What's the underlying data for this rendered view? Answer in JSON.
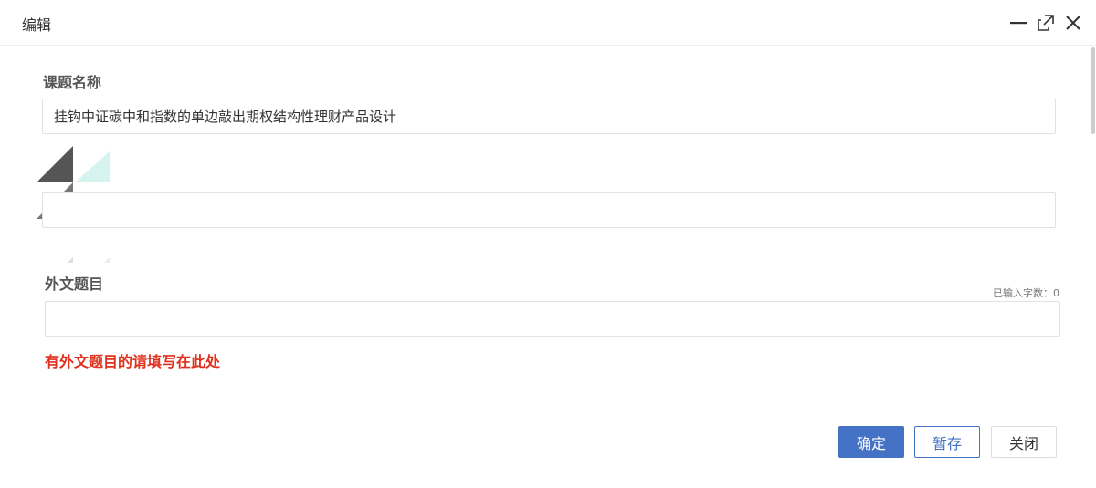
{
  "dialog": {
    "title": "编辑",
    "icons": {
      "minimize": "minimize-icon",
      "maximize": "maximize-icon",
      "close": "close-icon"
    }
  },
  "form": {
    "topic": {
      "label": "课题名称",
      "value": "挂钩中证碳中和指数的单边敲出期权结构性理财产品设计"
    },
    "second_field": {
      "value": ""
    },
    "foreign_title": {
      "label": "外文题目",
      "value": "",
      "char_count": "已输入字数：0",
      "hint": "有外文题目的请填写在此处"
    }
  },
  "buttons": {
    "confirm": "确定",
    "draft": "暂存",
    "close": "关闭"
  },
  "colors": {
    "primary": "#4472c4",
    "hint_red": "#e0301e",
    "logo_dark": "#555555",
    "logo_light": "#d5f3ef"
  }
}
